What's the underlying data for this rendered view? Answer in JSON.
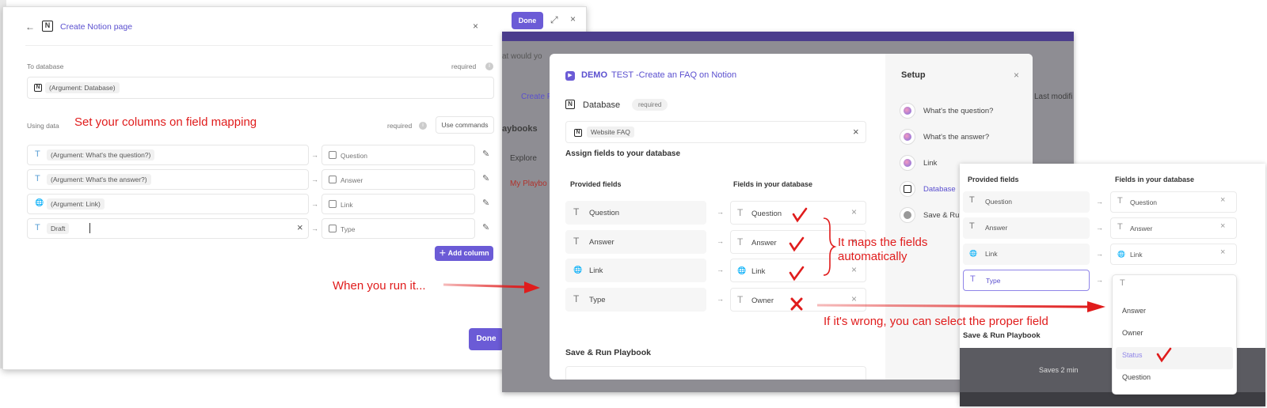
{
  "panel1": {
    "title": "Create Notion page",
    "to_database_label": "To database",
    "required": "required",
    "database_value": "(Argument: Database)",
    "using_data_label": "Using data",
    "use_commands": "Use commands",
    "annotation": "Set your columns on field mapping",
    "rows": [
      {
        "arg": "(Argument: What's the question?)",
        "db": "Question"
      },
      {
        "arg": "(Argument: What's the answer?)",
        "db": "Answer"
      },
      {
        "arg": "(Argument: Link)",
        "db": "Link"
      },
      {
        "arg": "Draft",
        "db": "Type"
      }
    ],
    "add_column": "Add column",
    "done": "Done"
  },
  "topbar": {
    "done": "Done"
  },
  "backdrop": {
    "search_hint": "at would yo",
    "create": "Create F",
    "playbooks": "aybooks",
    "explore": "Explore",
    "my_playbooks": "My Playbo",
    "last_modified": "Last modifi"
  },
  "panel2": {
    "title_demo": "DEMO",
    "title_rest": "TEST -Create an FAQ on Notion",
    "database_label": "Database",
    "required": "required",
    "database_value": "Website FAQ",
    "assign": "Assign fields to your database",
    "provided_header": "Provided fields",
    "db_header": "Fields in your database",
    "rows": [
      {
        "provided": "Question",
        "db": "Question"
      },
      {
        "provided": "Answer",
        "db": "Answer"
      },
      {
        "provided": "Link",
        "db": "Link"
      },
      {
        "provided": "Type",
        "db": "Owner"
      }
    ],
    "save_run": "Save & Run Playbook"
  },
  "setup": {
    "title": "Setup",
    "items": [
      "What's the question?",
      "What's the answer?",
      "Link",
      "Database",
      "Save & Ru"
    ]
  },
  "panel3": {
    "provided_header": "Provided fields",
    "db_header": "Fields in your database",
    "rows": [
      {
        "provided": "Question",
        "db": "Question"
      },
      {
        "provided": "Answer",
        "db": "Answer"
      },
      {
        "provided": "Link",
        "db": "Link"
      },
      {
        "provided": "Type",
        "db": ""
      }
    ],
    "save_run": "Save & Run Playbook",
    "saves": "Saves 2 min",
    "dropdown": [
      "Answer",
      "Owner",
      "Status",
      "Question"
    ]
  },
  "annotations": {
    "run": "When you run it...",
    "maps": "It maps the fields automatically",
    "wrong": "If it's wrong, you can select the proper field"
  }
}
